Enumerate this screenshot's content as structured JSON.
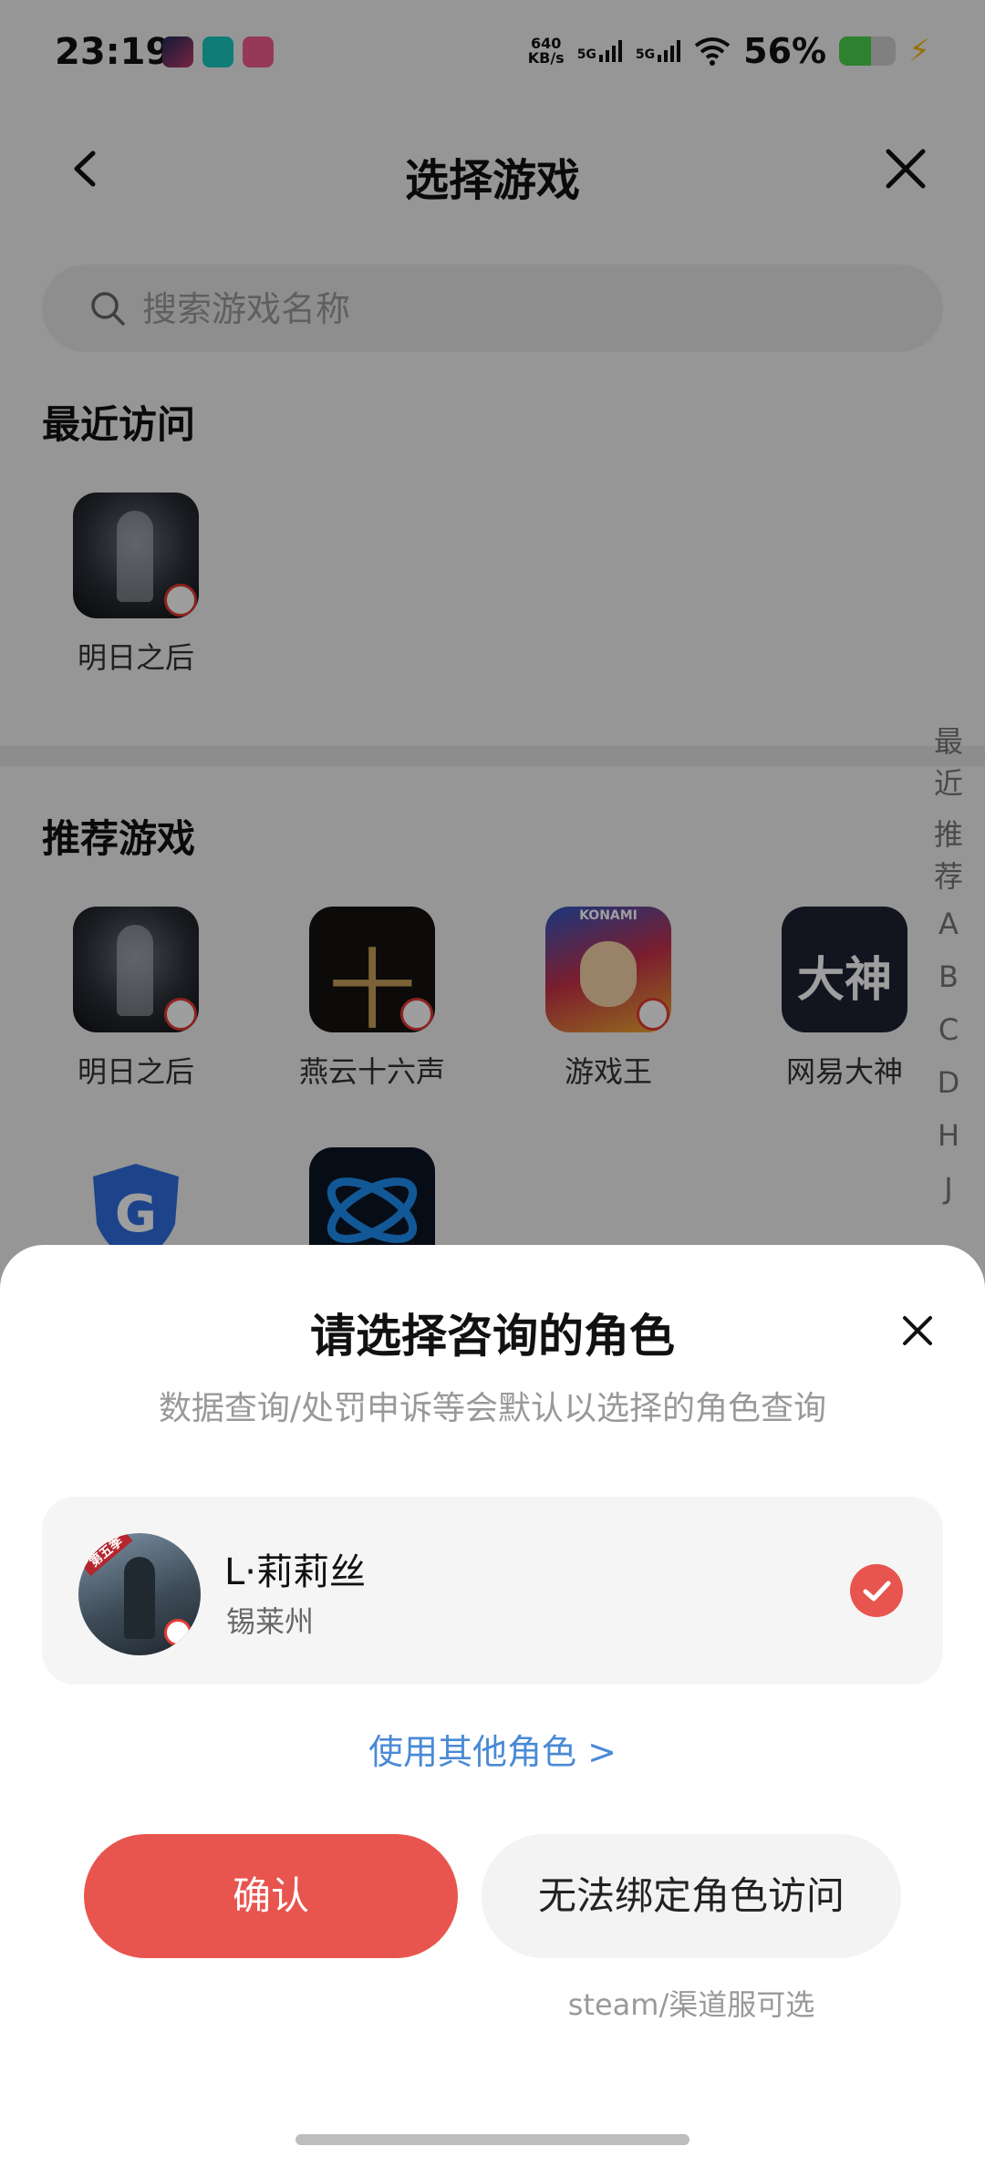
{
  "status_bar": {
    "time": "23:19",
    "net_speed_value": "640",
    "net_speed_unit": "KB/s",
    "signal_1": "5G",
    "signal_2": "5G",
    "battery_percent": "56%",
    "battery_level": 0.56,
    "app_icons": [
      "game-app-icon",
      "tap-app-icon",
      "bilibili-app-icon"
    ]
  },
  "header": {
    "title": "选择游戏"
  },
  "search": {
    "placeholder": "搜索游戏名称"
  },
  "recent": {
    "title": "最近访问",
    "games": [
      {
        "name": "明日之后"
      }
    ]
  },
  "recommended": {
    "title": "推荐游戏",
    "games": [
      {
        "name": "明日之后"
      },
      {
        "name": "燕云十六声",
        "icon_text": "十"
      },
      {
        "name": "游戏王",
        "icon_text": "KONAMI"
      },
      {
        "name": "网易大神",
        "icon_text": "大神"
      },
      {
        "name": ""
      },
      {
        "name": ""
      }
    ]
  },
  "alpha_index": [
    "最",
    "近",
    "推",
    "荐",
    "A",
    "B",
    "C",
    "D",
    "H",
    "J"
  ],
  "sheet": {
    "title": "请选择咨询的角色",
    "subtitle": "数据查询/处罚申诉等会默认以选择的角色查询",
    "role": {
      "name": "L·莉莉丝",
      "server": "锡莱州",
      "avatar_badge": "第五季",
      "selected": true
    },
    "other_role_link": "使用其他角色 >",
    "confirm_label": "确认",
    "unbind_label": "无法绑定角色访问",
    "unbind_note": "steam/渠道服可选"
  },
  "colors": {
    "accent_red": "#e8554e",
    "link_blue": "#4a8ad6",
    "battery_green": "#49d14d"
  }
}
